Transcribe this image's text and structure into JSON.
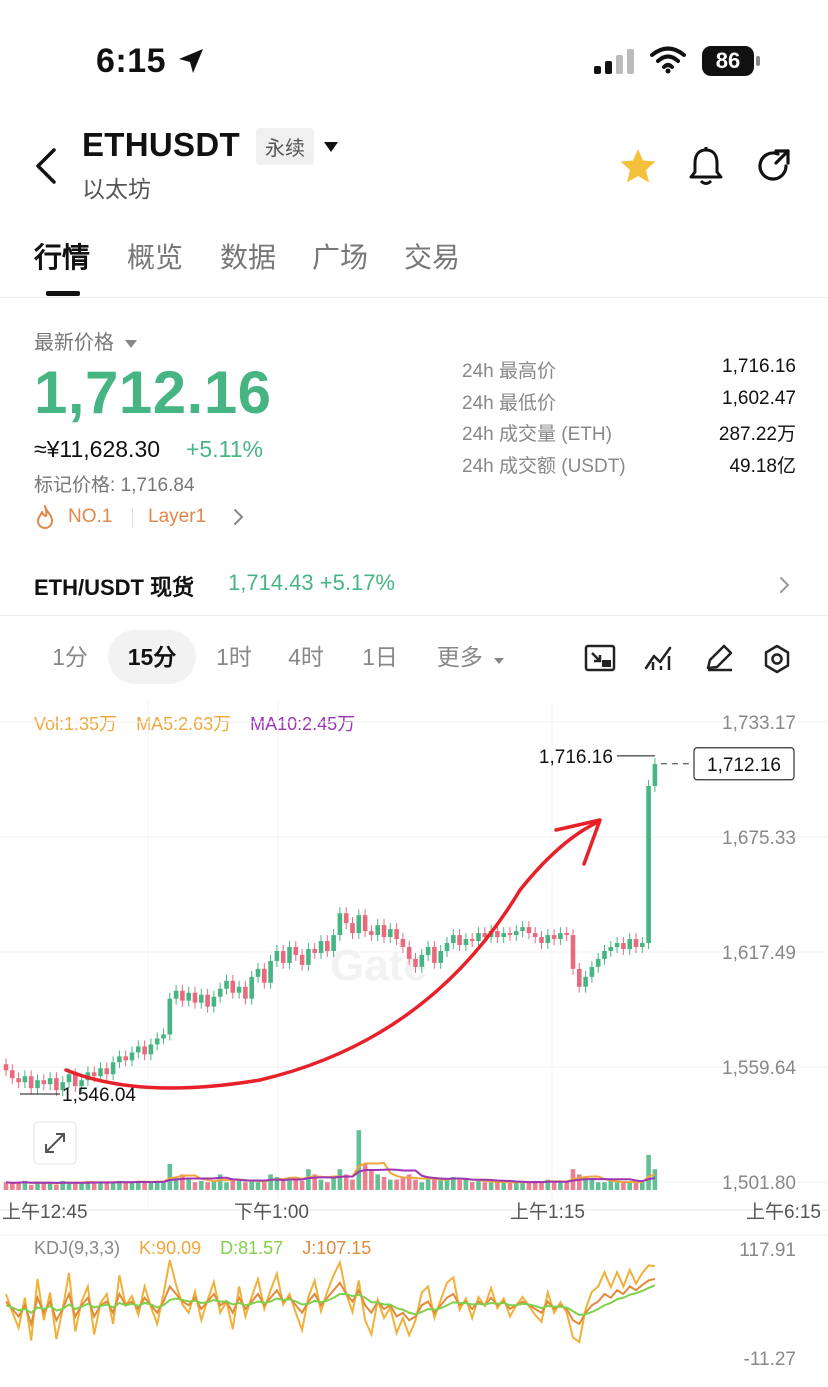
{
  "status_bar": {
    "time": "6:15",
    "battery": "86"
  },
  "header": {
    "pair": "ETHUSDT",
    "contract_tag": "永续",
    "subtitle": "以太坊"
  },
  "tabs": [
    "行情",
    "概览",
    "数据",
    "广场",
    "交易"
  ],
  "price": {
    "label": "最新价格",
    "last": "1,712.16",
    "cny": "≈¥11,628.30",
    "change": "+5.11%",
    "mark": "标记价格: 1,716.84",
    "tag_rank": "NO.1",
    "tag_sector": "Layer1"
  },
  "stats": [
    {
      "k": "24h 最高价",
      "v": "1,716.16"
    },
    {
      "k": "24h 最低价",
      "v": "1,602.47"
    },
    {
      "k": "24h 成交量 (ETH)",
      "v": "287.22万"
    },
    {
      "k": "24h 成交额 (USDT)",
      "v": "49.18亿"
    }
  ],
  "spot": {
    "name": "ETH/USDT 现货",
    "price": "1,714.43",
    "change": "+5.17%"
  },
  "intervals": [
    "1分",
    "15分",
    "1时",
    "4时",
    "1日",
    "更多"
  ],
  "active_interval": "15分",
  "legends": {
    "vol": "Vol:1.35万",
    "ma5": "MA5:2.63万",
    "ma10": "MA10:2.45万",
    "kdj": "KDJ(9,3,3)",
    "k": "K:90.09",
    "d": "D:81.57",
    "j": "J:107.15"
  },
  "colors": {
    "up": "#46b583",
    "down": "#e96a7c",
    "vol_ma5": "#f0a63a",
    "vol_ma10": "#9c36b5",
    "kdj_d": "#7fd04a",
    "annotation": "#e8202a"
  },
  "chart_data": {
    "type": "candlestick",
    "y_ticks": [
      "1,733.17",
      "1,675.33",
      "1,617.49",
      "1,559.64",
      "1,501.80"
    ],
    "x_ticks": [
      "上午12:45",
      "下午1:00",
      "上午1:15",
      "上午6:15"
    ],
    "high_label": "1,716.16",
    "low_label": "1,546.04",
    "last_label": "1,712.16",
    "kdj_ticks": [
      "117.91",
      "-11.27"
    ],
    "watermark": "Gate",
    "close": [
      1558,
      1554,
      1552,
      1555,
      1549,
      1553,
      1551,
      1554,
      1548,
      1552,
      1556,
      1550,
      1553,
      1557,
      1555,
      1559,
      1556,
      1562,
      1565,
      1563,
      1567,
      1570,
      1566,
      1571,
      1574,
      1576,
      1594,
      1598,
      1593,
      1597,
      1592,
      1596,
      1590,
      1595,
      1599,
      1603,
      1597,
      1600,
      1594,
      1605,
      1609,
      1602,
      1613,
      1618,
      1612,
      1620,
      1616,
      1611,
      1619,
      1617,
      1623,
      1618,
      1626,
      1637,
      1632,
      1627,
      1636,
      1628,
      1626,
      1631,
      1625,
      1629,
      1624,
      1620,
      1614,
      1610,
      1616,
      1620,
      1612,
      1618,
      1622,
      1626,
      1621,
      1624,
      1623,
      1627,
      1625,
      1628,
      1625,
      1627,
      1626,
      1628,
      1630,
      1627,
      1625,
      1622,
      1626,
      1624,
      1627,
      1626,
      1609,
      1600,
      1605,
      1610,
      1614,
      1618,
      1620,
      1622,
      1619,
      1624,
      1620,
      1622,
      1701,
      1712
    ],
    "volume": [
      0.3,
      0.25,
      0.3,
      0.35,
      0.2,
      0.3,
      0.25,
      0.3,
      0.2,
      0.35,
      0.3,
      0.25,
      0.3,
      0.35,
      0.3,
      0.3,
      0.25,
      0.3,
      0.35,
      0.3,
      0.3,
      0.35,
      0.3,
      0.3,
      0.35,
      0.3,
      1.0,
      0.5,
      0.6,
      0.4,
      0.3,
      0.35,
      0.3,
      0.35,
      0.6,
      0.3,
      0.4,
      0.35,
      0.3,
      0.4,
      0.3,
      0.3,
      0.6,
      0.5,
      0.4,
      0.5,
      0.4,
      0.35,
      0.8,
      0.6,
      0.4,
      0.3,
      0.5,
      0.8,
      0.6,
      0.4,
      2.3,
      1.0,
      0.8,
      0.6,
      0.5,
      0.4,
      0.4,
      0.5,
      0.6,
      0.4,
      0.3,
      0.4,
      0.5,
      0.4,
      0.4,
      0.5,
      0.4,
      0.4,
      0.3,
      0.35,
      0.3,
      0.3,
      0.3,
      0.3,
      0.3,
      0.3,
      0.3,
      0.3,
      0.35,
      0.3,
      0.4,
      0.3,
      0.3,
      0.3,
      0.8,
      0.6,
      0.5,
      0.4,
      0.3,
      0.3,
      0.35,
      0.3,
      0.3,
      0.3,
      0.3,
      0.3,
      1.35,
      0.8
    ],
    "kdj_k": [
      60,
      50,
      40,
      55,
      30,
      65,
      45,
      60,
      35,
      50,
      70,
      40,
      55,
      65,
      40,
      55,
      60,
      45,
      70,
      55,
      60,
      50,
      65,
      55,
      45,
      60,
      80,
      70,
      60,
      55,
      65,
      50,
      60,
      70,
      55,
      60,
      45,
      65,
      50,
      60,
      70,
      55,
      65,
      75,
      60,
      65,
      55,
      45,
      60,
      70,
      55,
      65,
      75,
      85,
      70,
      60,
      75,
      55,
      45,
      60,
      50,
      55,
      40,
      45,
      35,
      40,
      55,
      60,
      45,
      55,
      65,
      70,
      55,
      60,
      50,
      60,
      55,
      65,
      55,
      60,
      50,
      55,
      60,
      55,
      50,
      45,
      60,
      50,
      55,
      50,
      35,
      30,
      45,
      55,
      60,
      70,
      65,
      75,
      70,
      80,
      75,
      82,
      88,
      90
    ],
    "kdj_d": [
      55,
      52,
      48,
      50,
      45,
      52,
      50,
      54,
      48,
      50,
      56,
      50,
      53,
      57,
      52,
      54,
      56,
      52,
      58,
      55,
      57,
      54,
      58,
      56,
      52,
      55,
      62,
      64,
      62,
      60,
      61,
      58,
      59,
      62,
      60,
      60,
      56,
      58,
      55,
      57,
      60,
      58,
      60,
      64,
      62,
      63,
      60,
      56,
      57,
      61,
      59,
      61,
      65,
      70,
      70,
      67,
      69,
      65,
      59,
      59,
      56,
      56,
      51,
      49,
      45,
      43,
      46,
      50,
      49,
      51,
      55,
      59,
      58,
      58,
      56,
      57,
      56,
      58,
      57,
      58,
      55,
      55,
      57,
      56,
      54,
      51,
      54,
      53,
      53,
      52,
      47,
      42,
      43,
      46,
      50,
      55,
      58,
      63,
      65,
      69,
      71,
      74,
      78,
      81.57
    ],
    "kdj_j": [
      70,
      46,
      25,
      65,
      8,
      90,
      35,
      72,
      10,
      50,
      98,
      20,
      60,
      80,
      16,
      58,
      70,
      30,
      95,
      55,
      67,
      42,
      80,
      53,
      30,
      70,
      115,
      82,
      56,
      45,
      73,
      35,
      62,
      86,
      45,
      60,
      23,
      80,
      40,
      66,
      90,
      50,
      75,
      97,
      56,
      70,
      45,
      22,
      66,
      88,
      47,
      73,
      95,
      112,
      70,
      46,
      88,
      35,
      16,
      62,
      38,
      52,
      18,
      38,
      15,
      35,
      72,
      80,
      38,
      62,
      85,
      92,
      49,
      64,
      38,
      66,
      54,
      78,
      51,
      64,
      40,
      55,
      66,
      54,
      42,
      33,
      72,
      45,
      59,
      45,
      12,
      6,
      50,
      73,
      80,
      99,
      79,
      99,
      80,
      102,
      84,
      98,
      108,
      107.15
    ]
  }
}
